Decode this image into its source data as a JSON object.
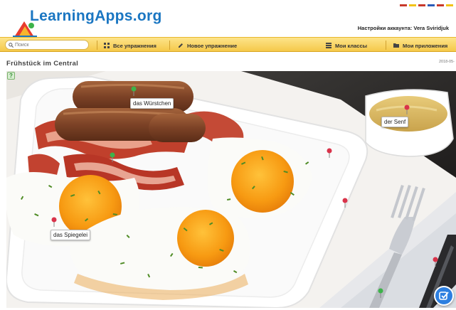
{
  "header": {
    "logo_text": "LearningApps.org",
    "account_text": "Настройки аккаунта: Vera Sviridjuk"
  },
  "nav": {
    "search_placeholder": "Поиск",
    "items": [
      {
        "label": "Все упражнения",
        "icon": "grid-icon"
      },
      {
        "label": "Новое упражнение",
        "icon": "pencil-icon"
      },
      {
        "label": "Мои классы",
        "icon": "list-icon"
      },
      {
        "label": "Мои приложения",
        "icon": "folder-icon"
      }
    ]
  },
  "page": {
    "title": "Frühstück im Central",
    "date": "2018-05-"
  },
  "exercise": {
    "help_glyph": "?",
    "labels": [
      "das Würstchen",
      "der Senf",
      "das Spiegelei"
    ],
    "colors": {
      "pin_green": "#3db34a",
      "pin_red": "#d9334a",
      "check_button": "#2d7fe0",
      "nav_bar": "#f5c94a",
      "logo_blue": "#1a76c2"
    }
  }
}
